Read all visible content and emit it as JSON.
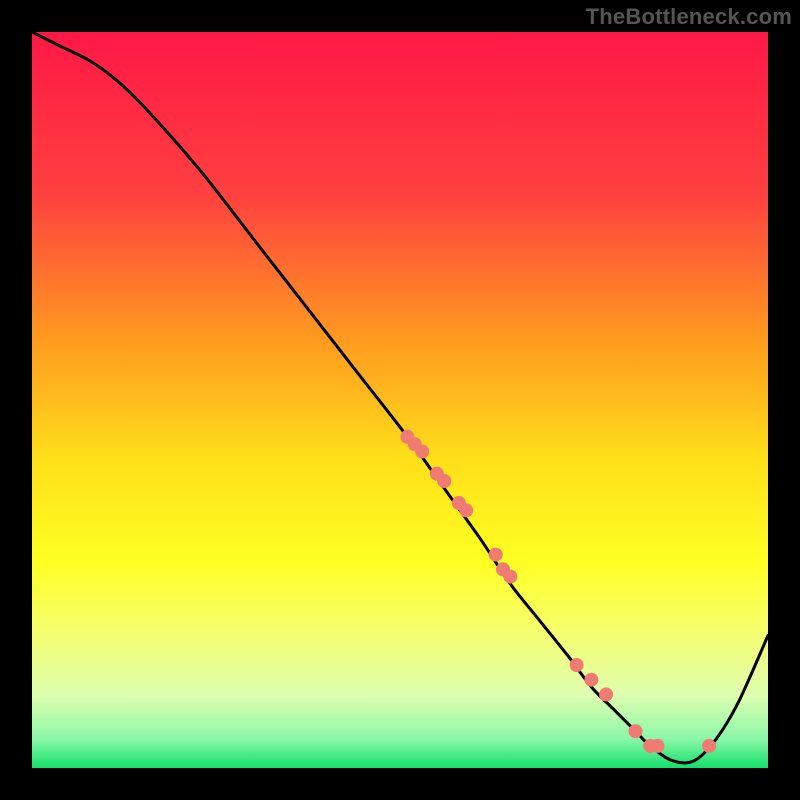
{
  "watermark": "TheBottleneck.com",
  "chart_data": {
    "type": "line",
    "title": "",
    "xlabel": "",
    "ylabel": "",
    "xlim": [
      0,
      100
    ],
    "ylim": [
      0,
      100
    ],
    "curve": {
      "x": [
        0,
        4,
        8,
        12,
        16,
        23,
        30,
        37,
        44,
        51,
        56,
        61,
        65,
        69,
        73,
        76,
        79,
        82,
        84,
        87,
        90,
        93,
        96,
        100
      ],
      "y": [
        100,
        98,
        96,
        93,
        89,
        81,
        72,
        63,
        54,
        45,
        38,
        31,
        25,
        20,
        15,
        11,
        8,
        5,
        3,
        1,
        1,
        4,
        9,
        18
      ]
    },
    "data_points": {
      "x": [
        51,
        52,
        53,
        55,
        56,
        58,
        59,
        63,
        64,
        65,
        74,
        76,
        78,
        82,
        84,
        85,
        92
      ],
      "y": [
        45,
        44,
        43,
        40,
        39,
        36,
        35,
        29,
        27,
        26,
        14,
        12,
        10,
        5,
        3,
        3,
        3
      ]
    },
    "gradient_stops": [
      {
        "offset": 0.0,
        "color": "#ff1846"
      },
      {
        "offset": 0.22,
        "color": "#ff4040"
      },
      {
        "offset": 0.42,
        "color": "#ff9b1f"
      },
      {
        "offset": 0.58,
        "color": "#ffdf1a"
      },
      {
        "offset": 0.72,
        "color": "#ffff22"
      },
      {
        "offset": 0.82,
        "color": "#f5ff73"
      },
      {
        "offset": 0.9,
        "color": "#dfffb0"
      },
      {
        "offset": 0.96,
        "color": "#8cf7a8"
      },
      {
        "offset": 1.0,
        "color": "#14e06a"
      }
    ],
    "point_color": "#ef7b72",
    "point_radius_px": 7
  }
}
